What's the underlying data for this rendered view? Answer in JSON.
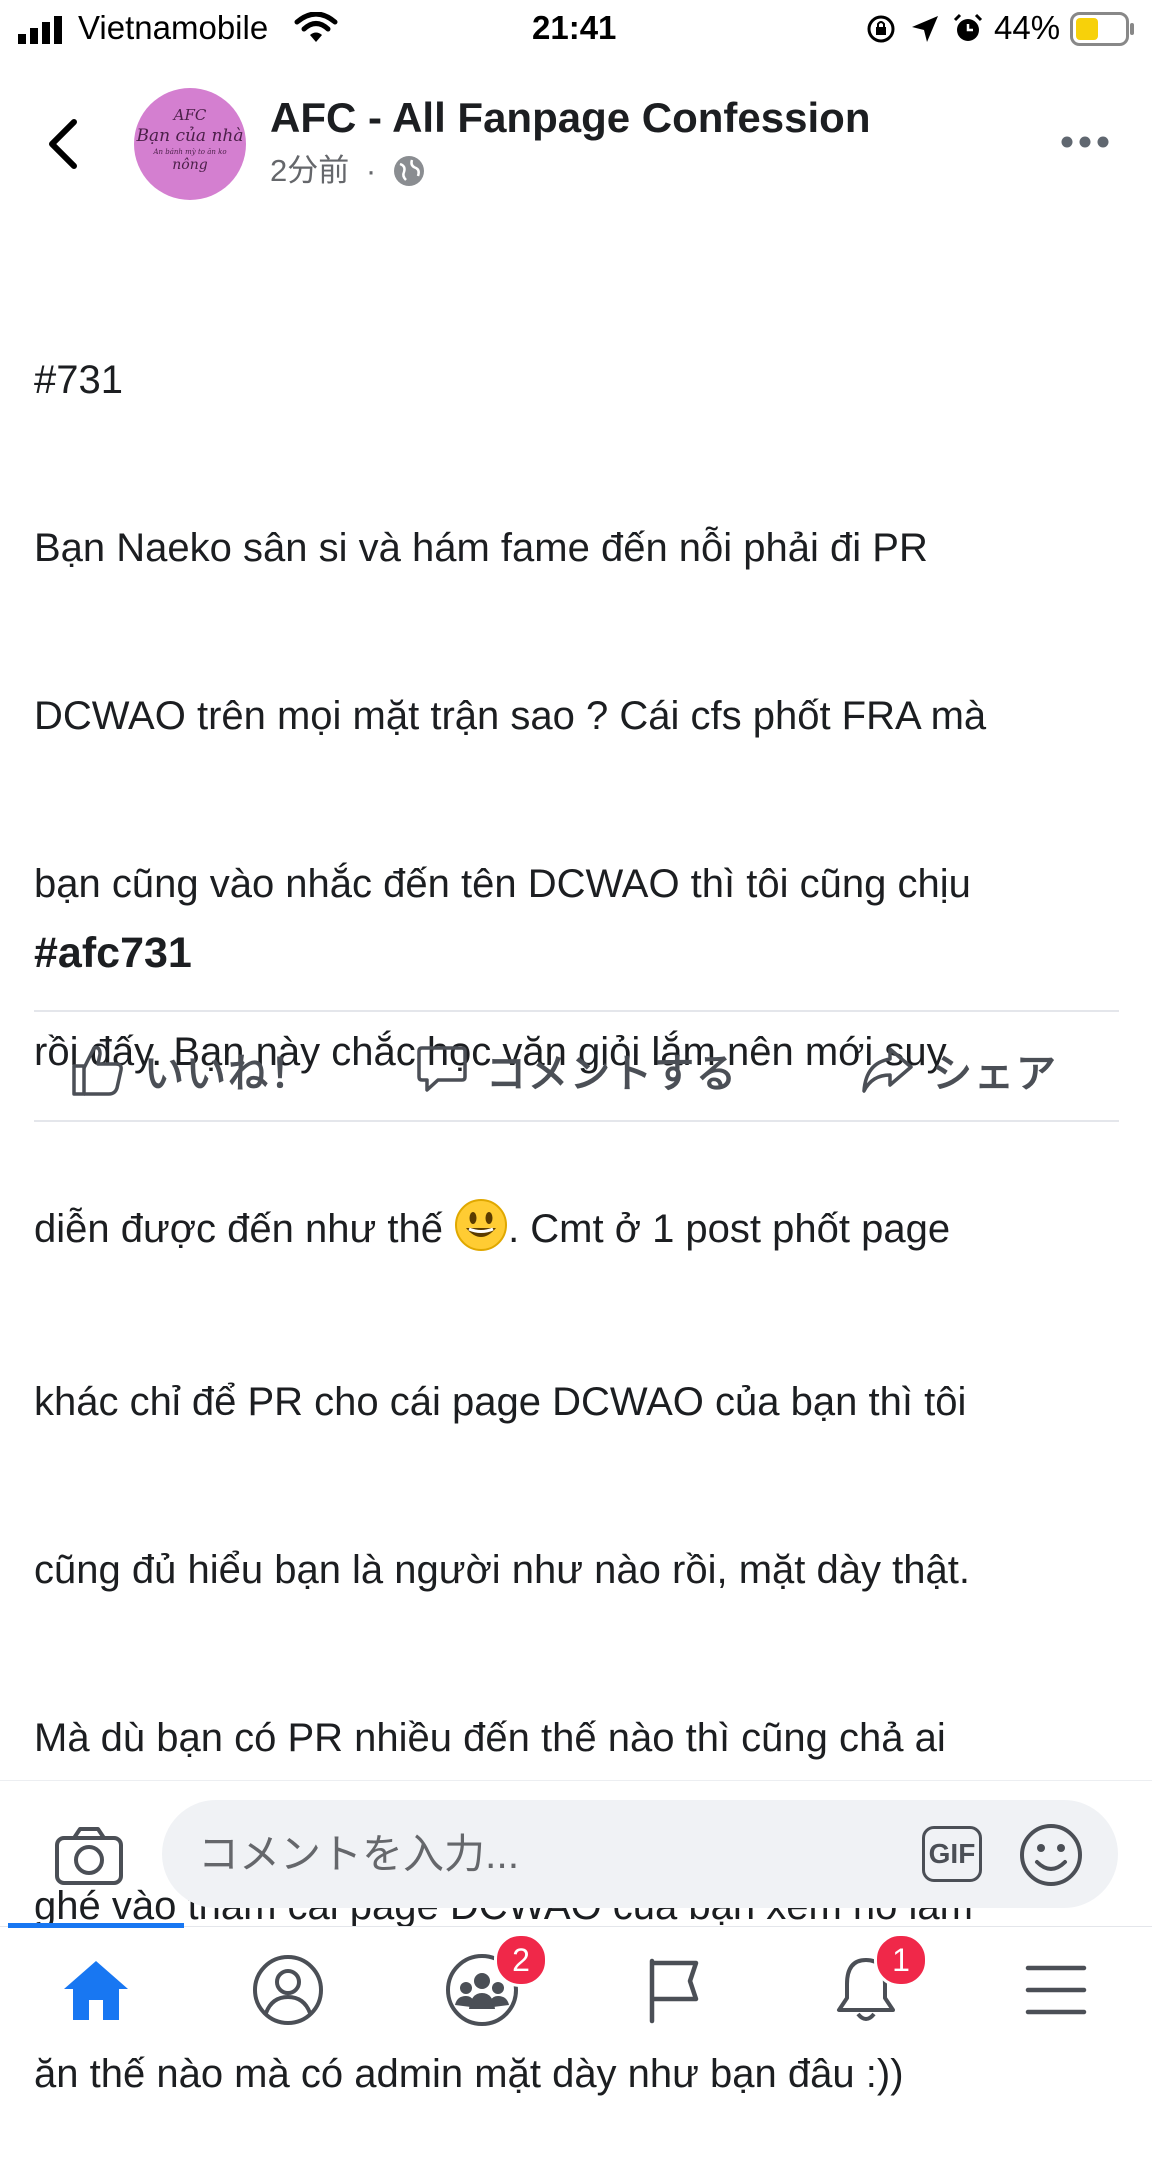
{
  "status_bar": {
    "carrier": "Vietnamobile",
    "time": "21:41",
    "battery_percent": "44%",
    "battery_level": 0.44
  },
  "post": {
    "page_name": "AFC - All Fanpage Confession",
    "time_ago": "2分前",
    "separator": "·",
    "audience_icon": "globe-icon",
    "avatar": {
      "line1": "AFC",
      "line2": "Bạn của nhà",
      "line3": "An bánh mỳ to ăn ko",
      "line4": "nông"
    },
    "body_line1": "#731",
    "body_line2": "Bạn Naeko sân si và hám fame đến nỗi phải đi PR",
    "body_line3": "DCWAO trên mọi mặt trận sao ? Cái cfs phốt FRA mà",
    "body_line4": "bạn cũng vào nhắc đến tên DCWAO thì tôi cũng chịu",
    "body_line5": "rồi đấy. Bạn này chắc học văn giỏi lắm nên mới suy",
    "body_line6_a": "diễn được đến như thế ",
    "body_emoji": "😃",
    "body_line6_b": ". Cmt ở 1 post phốt page",
    "body_line7": "khác chỉ để PR cho cái page DCWAO của bạn thì tôi",
    "body_line8": "cũng đủ hiểu bạn là người như nào rồi, mặt dày thật.",
    "body_line9": "Mà dù bạn có PR nhiều đến thế nào thì cũng chả ai",
    "body_line10": "ghé vào thăm cái page DCWAO của bạn xem nó làm",
    "body_line11": "ăn thế nào mà có admin mặt dày như bạn đâu :))",
    "hashtag": "#afc731"
  },
  "actions": {
    "like": "いいね！",
    "comment": "コメントする",
    "share": "シェア"
  },
  "comment_bar": {
    "placeholder": "コメントを入力...",
    "gif": "GIF"
  },
  "tab_bar": {
    "items": [
      {
        "icon": "home-icon",
        "active": true
      },
      {
        "icon": "profile-icon"
      },
      {
        "icon": "groups-icon",
        "badge": "2"
      },
      {
        "icon": "pages-flag-icon"
      },
      {
        "icon": "notifications-icon",
        "badge": "1"
      },
      {
        "icon": "menu-icon"
      }
    ]
  },
  "colors": {
    "accent": "#1877f2",
    "badge": "#f02849",
    "battery": "#f7d10a"
  }
}
